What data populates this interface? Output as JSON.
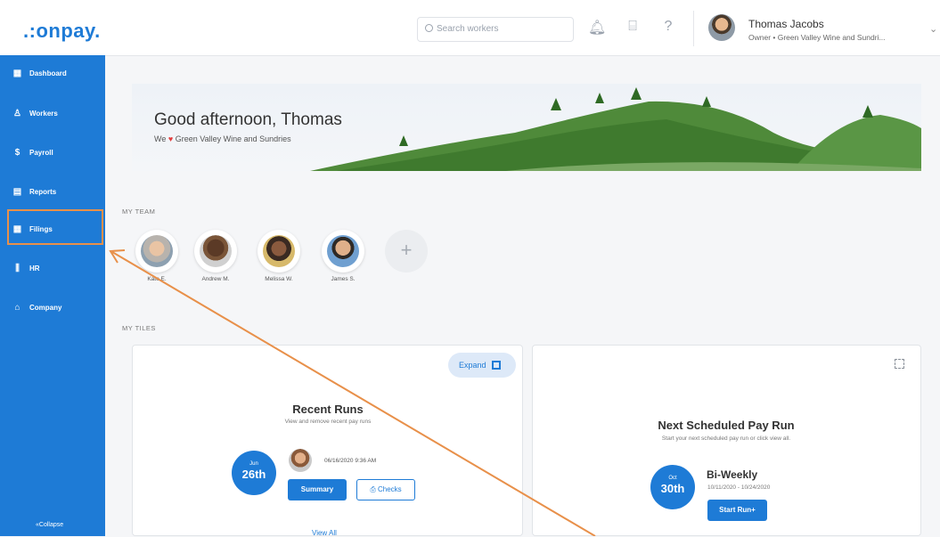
{
  "app": {
    "logo_text": ".:onpay."
  },
  "colors": {
    "brand_blue": "#1e7bd6",
    "highlight_orange": "#e8904a",
    "heart_red": "#e23d3d"
  },
  "header": {
    "search": {
      "placeholder": "Search workers"
    },
    "icons": [
      "bell-icon",
      "gift-icon",
      "help-icon"
    ],
    "user": {
      "name": "Thomas Jacobs",
      "role": "Owner • Green Valley Wine and Sundri..."
    }
  },
  "sidebar": {
    "items": [
      {
        "label": "Dashboard",
        "icon": "dashboard-icon"
      },
      {
        "label": "Workers",
        "icon": "workers-icon"
      },
      {
        "label": "Payroll",
        "icon": "payroll-icon"
      },
      {
        "label": "Reports",
        "icon": "reports-icon"
      },
      {
        "label": "Filings",
        "icon": "filings-icon"
      },
      {
        "label": "HR",
        "icon": "hr-icon"
      },
      {
        "label": "Company",
        "icon": "company-icon"
      }
    ],
    "collapse_label": "«Collapse"
  },
  "banner": {
    "greeting": "Good afternoon, Thomas",
    "we": "We",
    "company": "Green Valley Wine and Sundries"
  },
  "team": {
    "label": "MY TEAM",
    "members": [
      "Kate E.",
      "Andrew M.",
      "Melissa W.",
      "James S."
    ]
  },
  "tiles": {
    "label": "MY TILES",
    "recent_runs": {
      "expand_label": "Expand",
      "title": "Recent Runs",
      "subtitle": "View and remove recent pay runs",
      "date_month": "Jun",
      "date_day": "26th",
      "timestamp": "06/16/2020 9:36 AM",
      "summary_label": "Summary",
      "checks_label": "Checks",
      "view_all_label": "View All"
    },
    "next_run": {
      "title": "Next Scheduled Pay Run",
      "subtitle": "Start your next scheduled pay run or click view all.",
      "date_month": "Oct",
      "date_day": "30th",
      "frequency": "Bi-Weekly",
      "range": "10/11/2020 - 10/24/2020",
      "start_label": "Start Run"
    }
  }
}
